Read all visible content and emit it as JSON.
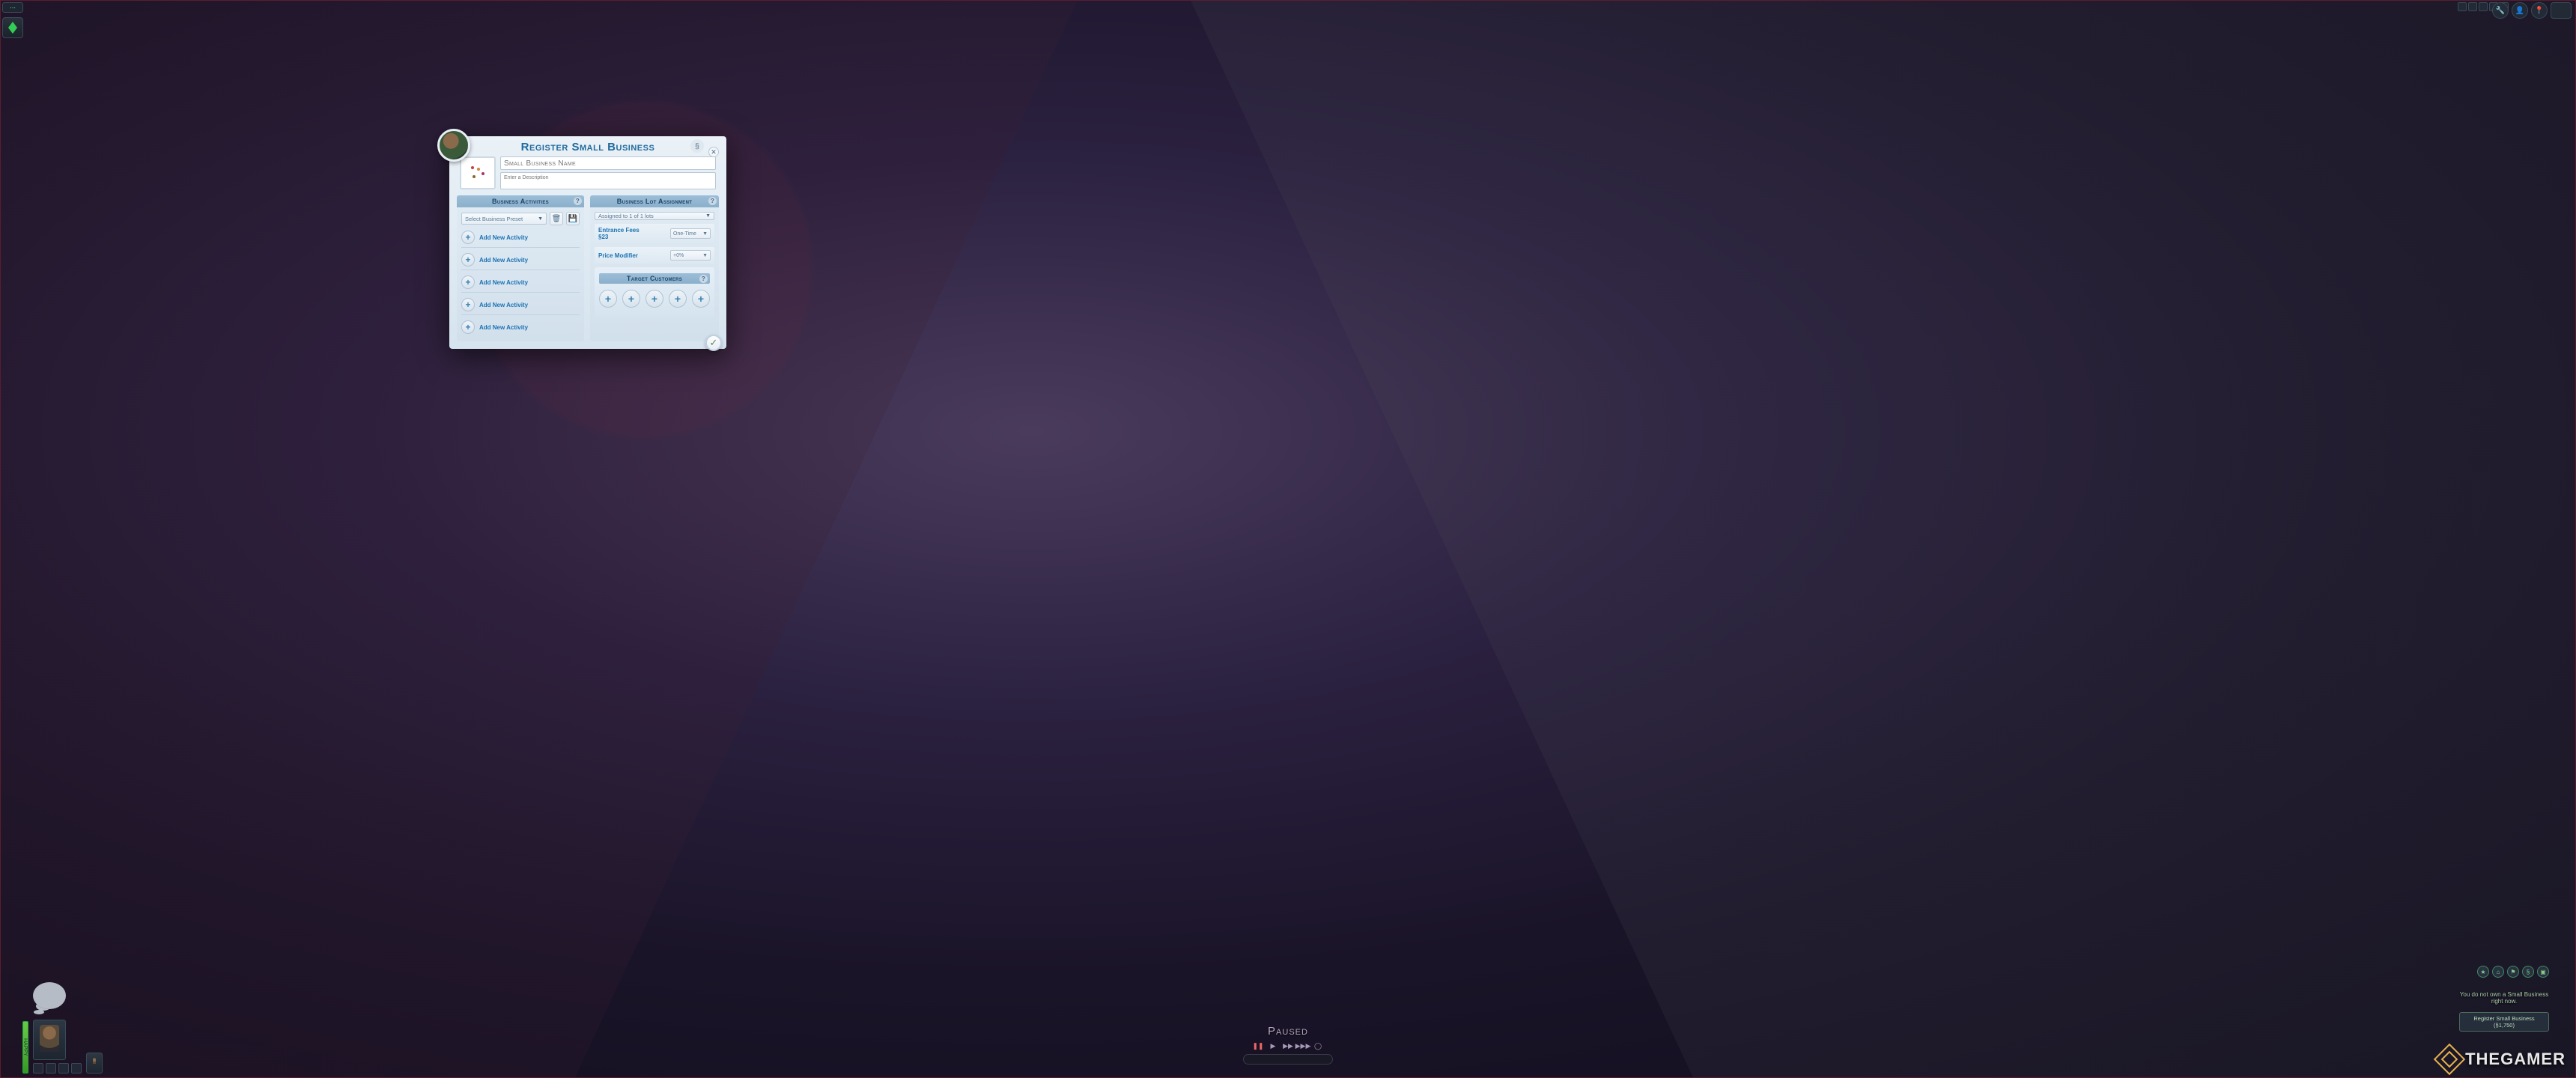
{
  "dialog": {
    "title": "Register Small Business",
    "close_glyph": "✕",
    "currency_glyph": "§",
    "name_placeholder": "Small Business Name",
    "desc_placeholder": "Enter a Description",
    "confirm_glyph": "✓",
    "left": {
      "header": "Business Activities",
      "help": "?",
      "preset_label": "Select Business Preset",
      "trash_glyph": "🗑",
      "save_glyph": "💾",
      "activities": [
        "Add New Activity",
        "Add New Activity",
        "Add New Activity",
        "Add New Activity",
        "Add New Activity"
      ]
    },
    "right": {
      "header": "Business Lot Assignment",
      "help": "?",
      "assigned_label": "Assigned to 1 of 1 lots",
      "fee_label": "Entrance Fees",
      "fee_value": "§23",
      "fee_mode": "One-Time",
      "price_label": "Price Modifier",
      "price_value": "+0%",
      "target_header": "Target Customers",
      "target_help": "?",
      "target_slots": 5
    }
  },
  "hud": {
    "paused": "Paused",
    "need_label": "HAPPY",
    "biz_msg": "You do not own a Small Business right now.",
    "biz_btn": "Register Small Business (§1,750)"
  },
  "watermark": "THEGAMER"
}
